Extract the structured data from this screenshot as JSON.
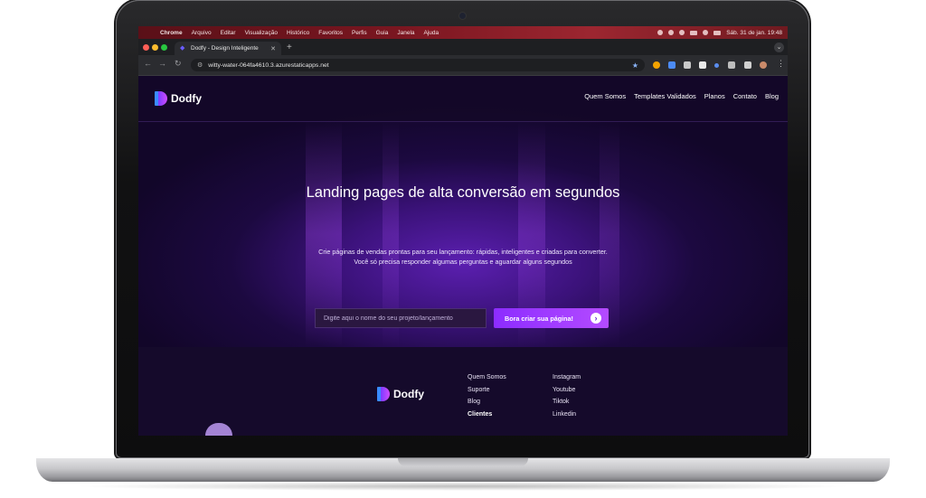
{
  "menubar": {
    "app": "Chrome",
    "items": [
      "Arquivo",
      "Editar",
      "Visualização",
      "Histórico",
      "Favoritos",
      "Perfis",
      "Guia",
      "Janela",
      "Ajuda"
    ],
    "clock": "Sáb. 31 de jan.  19:48"
  },
  "browser": {
    "tab_title": "Dodfy - Design Inteligente",
    "url": "witty-water-064fa4610.3.azurestaticapps.net"
  },
  "site": {
    "logo_text": "Dodfy",
    "nav": [
      "Quem Somos",
      "Templates Validados",
      "Planos",
      "Contato",
      "Blog"
    ],
    "hero_title": "Landing pages de alta conversão em segundos",
    "hero_sub_line1": "Crie páginas de vendas prontas para seu lançamento: rápidas, inteligentes e criadas para converter.",
    "hero_sub_line2": "Você só precisa responder algumas perguntas e aguardar alguns segundos",
    "input_placeholder": "Digite aqui o nome do seu projeto/lançamento",
    "cta_label": "Bora criar sua página!",
    "footer": {
      "logo_text": "Dodfy",
      "col1": [
        "Quem Somos",
        "Suporte",
        "Blog",
        "Clientes"
      ],
      "col2": [
        "Instagram",
        "Youtube",
        "Tiktok",
        "Linkedin"
      ]
    }
  },
  "colors": {
    "accent": "#9a35ff",
    "menubar": "#7a1620",
    "hero": "#3b127a"
  }
}
